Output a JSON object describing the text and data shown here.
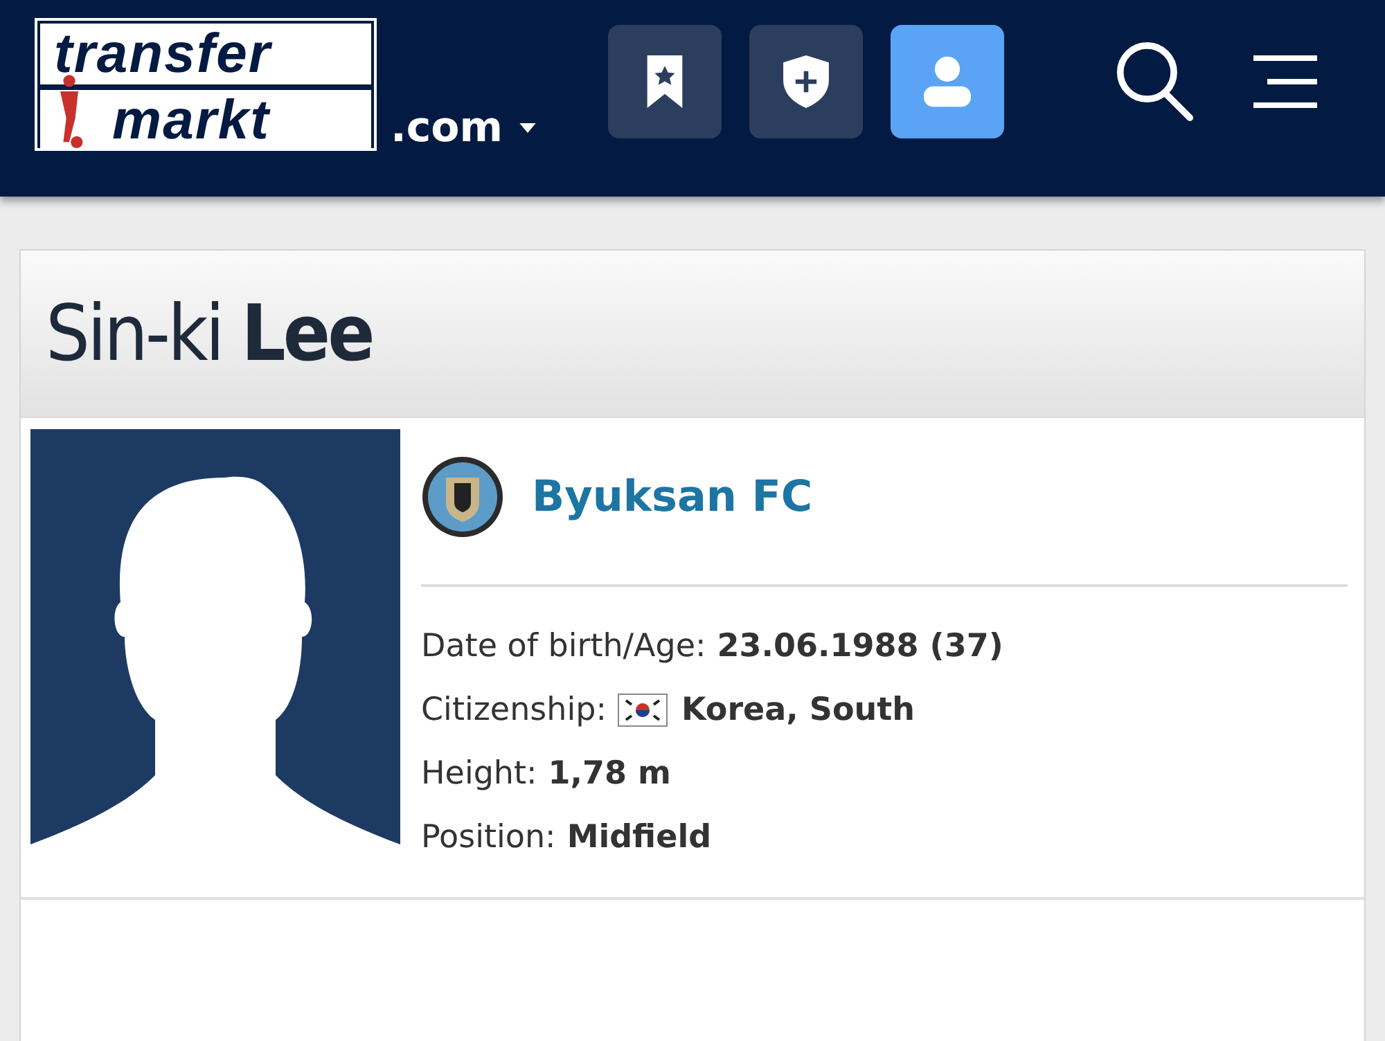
{
  "header": {
    "logo_top": "transfer",
    "logo_bottom": "markt",
    "domain": ".com",
    "nav_buttons": [
      {
        "kind": "watchlist",
        "selected": false
      },
      {
        "kind": "club",
        "selected": false
      },
      {
        "kind": "profile",
        "selected": true
      }
    ]
  },
  "player": {
    "first_name": "Sin-ki",
    "last_name": "Lee",
    "club": "Byuksan FC",
    "details": [
      {
        "kind": "text",
        "label": "Date of birth/Age:",
        "value": "23.06.1988 (37)"
      },
      {
        "kind": "flag",
        "label": "Citizenship:",
        "value": "Korea, South"
      },
      {
        "kind": "text",
        "label": "Height:",
        "value": "1,78 m"
      },
      {
        "kind": "text",
        "label": "Position:",
        "value": "Midfield"
      }
    ]
  }
}
